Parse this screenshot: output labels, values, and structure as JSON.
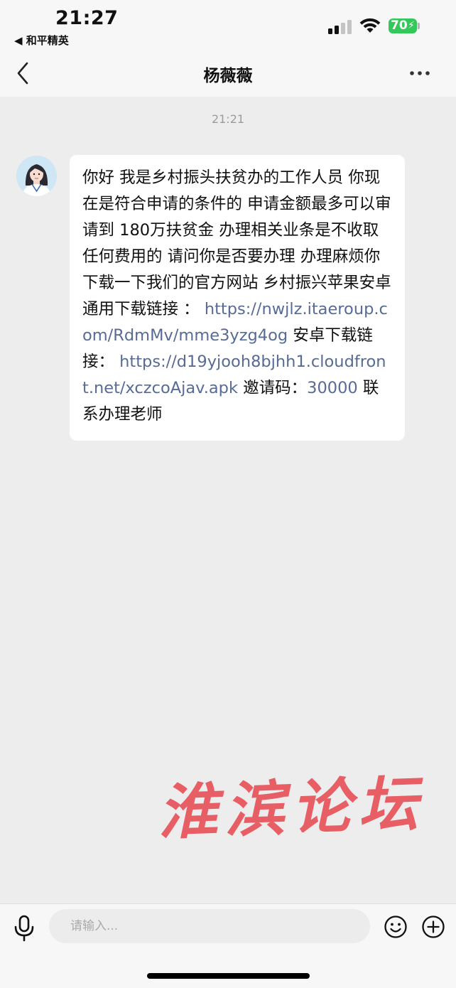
{
  "status_bar": {
    "time": "21:27",
    "back_app": "◀ 和平精英",
    "battery": "70"
  },
  "header": {
    "title": "杨薇薇"
  },
  "chat": {
    "timestamp": "21:21",
    "message": {
      "segments": [
        {
          "text": "你好   我是乡村振头扶贫办的工作人员 你现在是符合申请的条件的 申请金额最多可以审请到   180万扶贫金   办理相关业条是不收取任何费用的 请问你是否要办理     办理麻烦你下载一下我们的官方网站   乡村振兴苹果安卓通用下载链接 ：  ",
          "type": "text"
        },
        {
          "text": "https://nwjlz.itaeroup.com/RdmMv/mme3yzg4og",
          "type": "link"
        },
        {
          "text": " 安卓下载链接：  ",
          "type": "text"
        },
        {
          "text": "https://d19yjooh8bjhh1.cloudfront.net/xczcoAjav.apk",
          "type": "link"
        },
        {
          "text": " 邀请码：",
          "type": "text"
        },
        {
          "text": "30000",
          "type": "link"
        },
        {
          "text": " 联系办理老师",
          "type": "text"
        }
      ]
    }
  },
  "watermark": {
    "text": "淮滨论坛"
  },
  "input_bar": {
    "placeholder": "请输入..."
  },
  "colors": {
    "link": "#576b95",
    "watermark": "#e8525a",
    "battery": "#34c759"
  },
  "icons": [
    "back-chevron-icon",
    "more-icon",
    "microphone-icon",
    "emoji-icon",
    "plus-icon",
    "signal-icon",
    "wifi-icon"
  ]
}
